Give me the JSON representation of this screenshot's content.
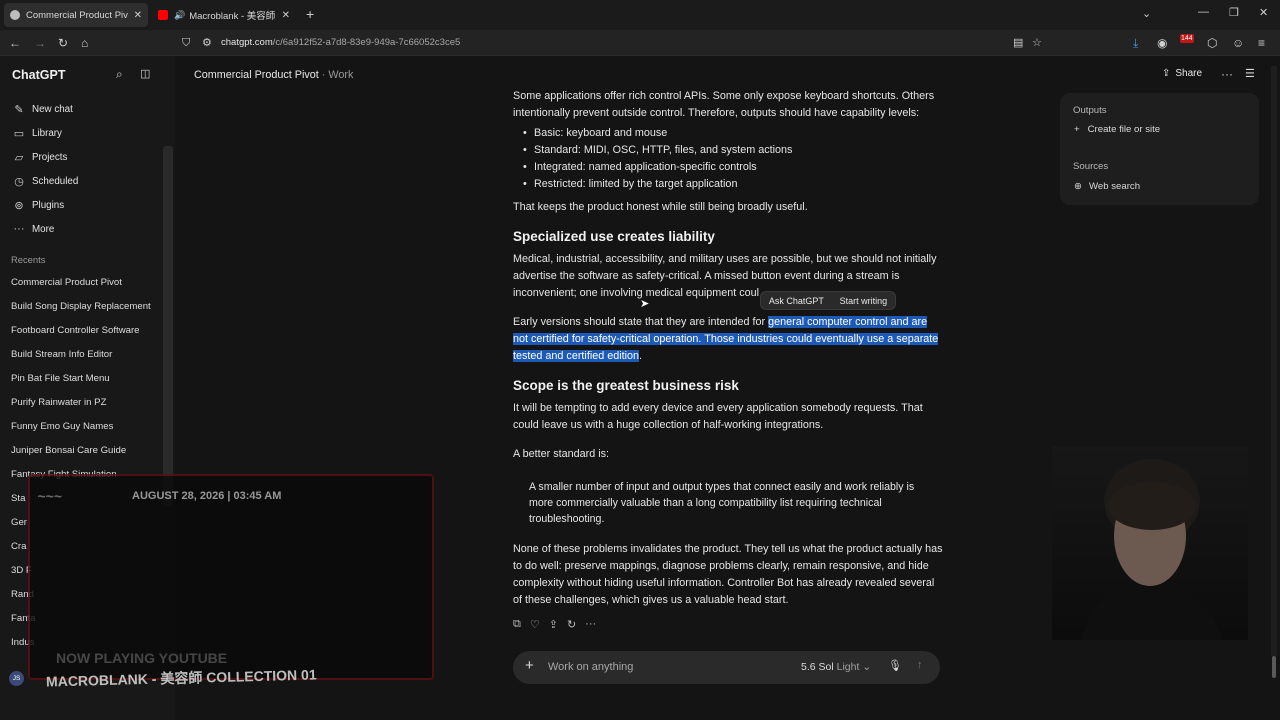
{
  "browser": {
    "tabs": [
      {
        "title": "Commercial Product Pivot",
        "active": true
      },
      {
        "title": "Macroblank - 美容師 COLLE",
        "active": false
      }
    ],
    "new_tab": "+",
    "url_host": "chatgpt.com",
    "url_path": "/c/6a912f52-a7d8-83e9-949a-7c66052c3ce5",
    "extension_badge": "144"
  },
  "sidebar": {
    "brand": "ChatGPT",
    "nav": [
      {
        "label": "New chat",
        "icon": "edit-icon"
      },
      {
        "label": "Library",
        "icon": "library-icon"
      },
      {
        "label": "Projects",
        "icon": "folder-icon"
      },
      {
        "label": "Scheduled",
        "icon": "clock-icon"
      },
      {
        "label": "Plugins",
        "icon": "plugin-icon"
      },
      {
        "label": "More",
        "icon": "more-icon"
      }
    ],
    "recents_label": "Recents",
    "recents": [
      "Commercial Product Pivot",
      "Build Song Display Replacement",
      "Footboard Controller Software",
      "Build Stream Info Editor",
      "Pin Bat File Start Menu",
      "Purify Rainwater in PZ",
      "Funny Emo Guy Names",
      "Juniper Bonsai Care Guide",
      "Fantasy Fight Simulation",
      "Sta",
      "Ger",
      "Cra",
      "3D F",
      "Rand",
      "Fanta",
      "Indus"
    ],
    "user_initials": "JS"
  },
  "header": {
    "title": "Commercial Product Pivot",
    "project": "Work",
    "share": "Share"
  },
  "conversation": {
    "p1": "Some applications offer rich control APIs. Some only expose keyboard shortcuts. Others intentionally prevent outside control. Therefore, outputs should have capability levels:",
    "bullets": [
      "Basic: keyboard and mouse",
      "Standard: MIDI, OSC, HTTP, files, and system actions",
      "Integrated: named application-specific controls",
      "Restricted: limited by the target application"
    ],
    "p2": "That keeps the product honest while still being broadly useful.",
    "h1": "Specialized use creates liability",
    "p3": "Medical, industrial, accessibility, and military uses are possible, but we should not initially advertise the software as safety-critical. A missed button event during a stream is inconvenient; one involving medical equipment coul",
    "p4_pre": "Early versions should state that they are intended for ",
    "p4_sel": "general computer control and are not certified for safety-critical operation. Those industries could eventually use a separate tested and certified edition",
    "p4_post": ".",
    "h2": "Scope is the greatest business risk",
    "p5": "It will be tempting to add every device and every application somebody requests. That could leave us with a huge collection of half-working integrations.",
    "p6": "A better standard is:",
    "quote": "A smaller number of input and output types that connect easily and work reliably is more commercially valuable than a long compatibility list requiring technical troubleshooting.",
    "p7": "None of these problems invalidates the product. They tell us what the product actually has to do well: preserve mappings, diagnose problems clearly, remain responsive, and hide complexity without hiding useful information. Controller Bot has already revealed several of these challenges, which gives us a valuable head start."
  },
  "selection_popup": {
    "ask": "Ask ChatGPT",
    "write": "Start writing"
  },
  "composer": {
    "placeholder": "Work on anything",
    "model": "5.6 Sol",
    "mode": "Light"
  },
  "panel": {
    "outputs_label": "Outputs",
    "create": "Create file or site",
    "sources_label": "Sources",
    "web_search": "Web search"
  },
  "overlay": {
    "date": "AUGUST 28, 2026 | 03:45 AM",
    "now_playing": "NOW PLAYING YOUTUBE",
    "track": "MACROBLANK - 美容師 COLLECTION 01"
  },
  "colors": {
    "selection": "#1d5ab8",
    "youtube": "#ff0000",
    "banner_red": "#a01414"
  }
}
